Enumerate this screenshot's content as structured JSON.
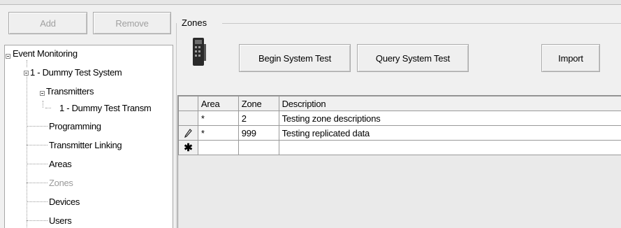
{
  "toolbar": {
    "add_label": "Add",
    "remove_label": "Remove"
  },
  "tree": {
    "nodes": [
      {
        "label": "Event Monitoring"
      },
      {
        "label": "1 - Dummy Test System"
      },
      {
        "label": "Transmitters"
      },
      {
        "label": "1 - Dummy Test Transm"
      },
      {
        "label": "Programming"
      },
      {
        "label": "Transmitter Linking"
      },
      {
        "label": "Areas"
      },
      {
        "label": "Zones"
      },
      {
        "label": "Devices"
      },
      {
        "label": "Users"
      }
    ]
  },
  "zones": {
    "title": "Zones",
    "begin_test_label": "Begin System Test",
    "query_test_label": "Query System Test",
    "import_label": "Import"
  },
  "grid": {
    "columns": [
      "Area",
      "Zone",
      "Description"
    ],
    "rows": [
      {
        "marker": "",
        "area": "*",
        "zone": "2",
        "description": "Testing zone descriptions"
      },
      {
        "marker": "pencil-icon",
        "area": "*",
        "zone": "999",
        "description": "Testing replicated data"
      },
      {
        "marker": "new-row-icon",
        "area": "",
        "zone": "",
        "description": ""
      }
    ]
  }
}
